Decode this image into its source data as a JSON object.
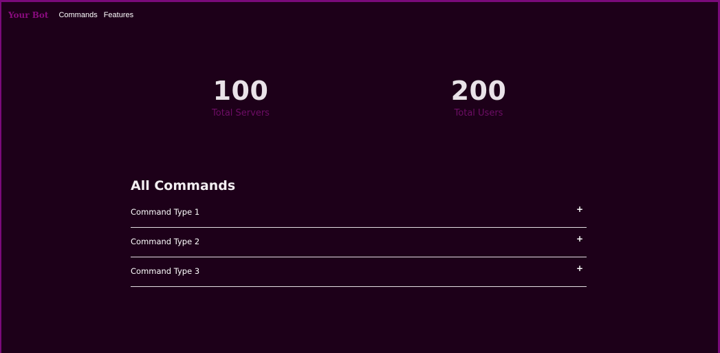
{
  "navbar": {
    "brand": "Your Bot",
    "links": [
      {
        "label": "Commands"
      },
      {
        "label": "Features"
      }
    ]
  },
  "stats": {
    "servers": {
      "value": "100",
      "label": "Total Servers"
    },
    "users": {
      "value": "200",
      "label": "Total Users"
    }
  },
  "commands": {
    "title": "All Commands",
    "items": [
      {
        "label": "Command Type 1",
        "toggle": "+"
      },
      {
        "label": "Command Type 2",
        "toggle": "+"
      },
      {
        "label": "Command Type 3",
        "toggle": "+"
      }
    ]
  },
  "colors": {
    "background": "#1d0019",
    "accent": "#7a0a7a",
    "brand": "#8a0b7f",
    "stat_label": "#6e0d66"
  }
}
